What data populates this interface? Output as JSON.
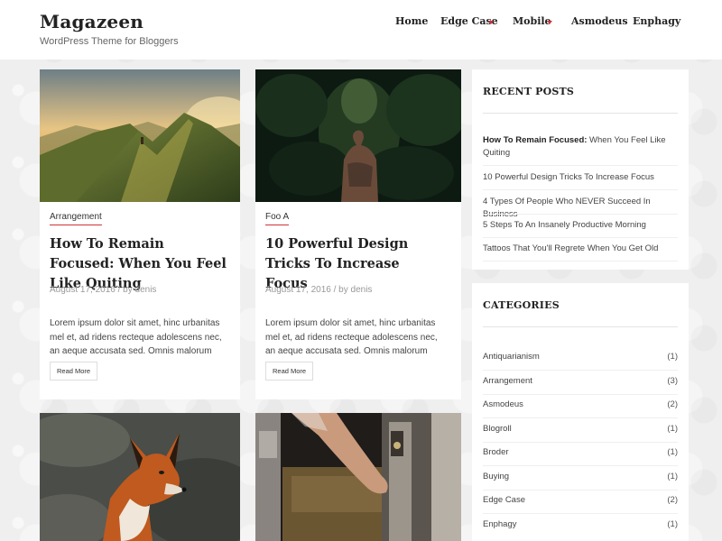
{
  "site": {
    "title": "Magazeen",
    "tagline": "WordPress Theme for Bloggers"
  },
  "nav": {
    "items": [
      {
        "label": "Home",
        "has_dropdown": false
      },
      {
        "label": "Edge Case",
        "has_dropdown": true
      },
      {
        "label": "Mobile",
        "has_dropdown": true
      },
      {
        "label": "Asmodeus",
        "has_dropdown": false
      },
      {
        "label": "Enphagy",
        "has_dropdown": false
      }
    ]
  },
  "posts": [
    {
      "category": "Arrangement",
      "title": "How To Remain Focused: When You Feel Like Quiting",
      "meta": "August 17, 2016 / by denis",
      "excerpt": "Lorem ipsum dolor sit amet, hinc urbanitas mel et, ad ridens recteque adolescens nec, an aeque accusata sed. Omnis malorum",
      "button": "Read More",
      "image": "mountain-ridge-hiker"
    },
    {
      "category": "Foo A",
      "title": "10 Powerful Design Tricks To Increase Focus",
      "meta": "August 17, 2016 / by denis",
      "excerpt": "Lorem ipsum dolor sit amet, hinc urbanitas mel et, ad ridens recteque adolescens nec, an aeque accusata sed. Omnis malorum",
      "button": "Read More",
      "image": "tattooed-man-forest"
    },
    {
      "image": "red-fox"
    },
    {
      "image": "hand-opening-door"
    }
  ],
  "recent_posts": {
    "title": "RECENT POSTS",
    "items": [
      {
        "bold": "How To Remain Focused:",
        "rest": " When You Feel Like Quiting"
      },
      {
        "bold": "",
        "rest": "10 Powerful Design Tricks To Increase Focus"
      },
      {
        "bold": "",
        "rest": "4 Types Of People Who NEVER Succeed In Business"
      },
      {
        "bold": "",
        "rest": "5 Steps To An Insanely Productive Morning"
      },
      {
        "bold": "",
        "rest": "Tattoos That You'll Regrete When You Get Old"
      }
    ]
  },
  "categories": {
    "title": "CATEGORIES",
    "items": [
      {
        "name": "Antiquarianism",
        "count": "(1)"
      },
      {
        "name": "Arrangement",
        "count": "(3)"
      },
      {
        "name": "Asmodeus",
        "count": "(2)"
      },
      {
        "name": "Blogroll",
        "count": "(1)"
      },
      {
        "name": "Broder",
        "count": "(1)"
      },
      {
        "name": "Buying",
        "count": "(1)"
      },
      {
        "name": "Edge Case",
        "count": "(2)"
      },
      {
        "name": "Enphagy",
        "count": "(1)"
      }
    ]
  },
  "colors": {
    "accent": "#d0323a",
    "text_dark": "#222222",
    "page_bg": "#efefef"
  }
}
